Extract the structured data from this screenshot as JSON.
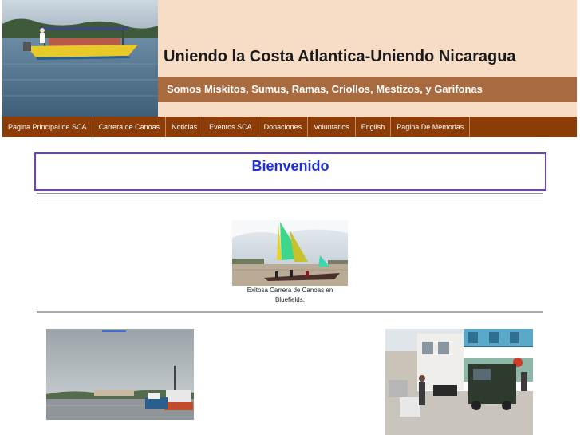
{
  "header": {
    "title": "Uniendo la Costa Atlantica-Uniendo Nicaragua",
    "subtitle": "Somos Miskitos, Sumus, Ramas, Criollos, Mestizos, y Garifonas"
  },
  "nav": {
    "items": [
      {
        "label": "Pagina Principal de SCA"
      },
      {
        "label": "Carrera de Canoas"
      },
      {
        "label": "Noticias"
      },
      {
        "label": "Eventos SCA"
      },
      {
        "label": "Donaciones"
      },
      {
        "label": "Voluntarios"
      },
      {
        "label": "English"
      },
      {
        "label": "Pagina De Memorias"
      }
    ]
  },
  "main": {
    "welcome": "Bienvenido",
    "caption": "Exitosa Carrera de Canoas en Bluefields."
  },
  "colors": {
    "header_bg": "#f7dcc6",
    "subtitle_bar": "#a86a3f",
    "nav_bg": "#8c3c06",
    "welcome_text": "#1d2fd6",
    "welcome_border": "#6a3ed0"
  }
}
